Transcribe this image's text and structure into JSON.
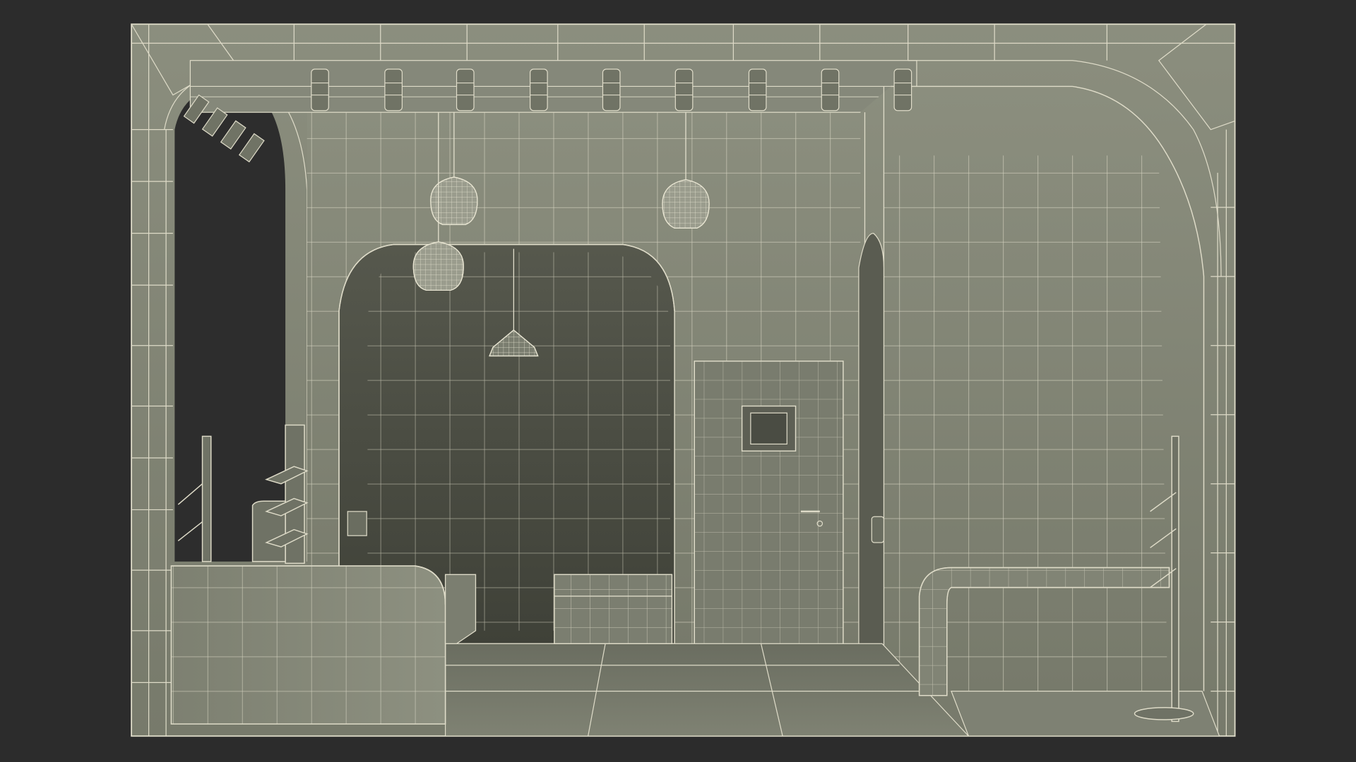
{
  "scene": {
    "background_color": "#2c2c2c",
    "wall_color": "#8e9181",
    "wall_dark_color": "#6f7265",
    "recess_color": "#4a4c43",
    "floor_color": "#7b7e70",
    "wire_color": "#dedbc8",
    "void_color": "#2d2d2d"
  }
}
